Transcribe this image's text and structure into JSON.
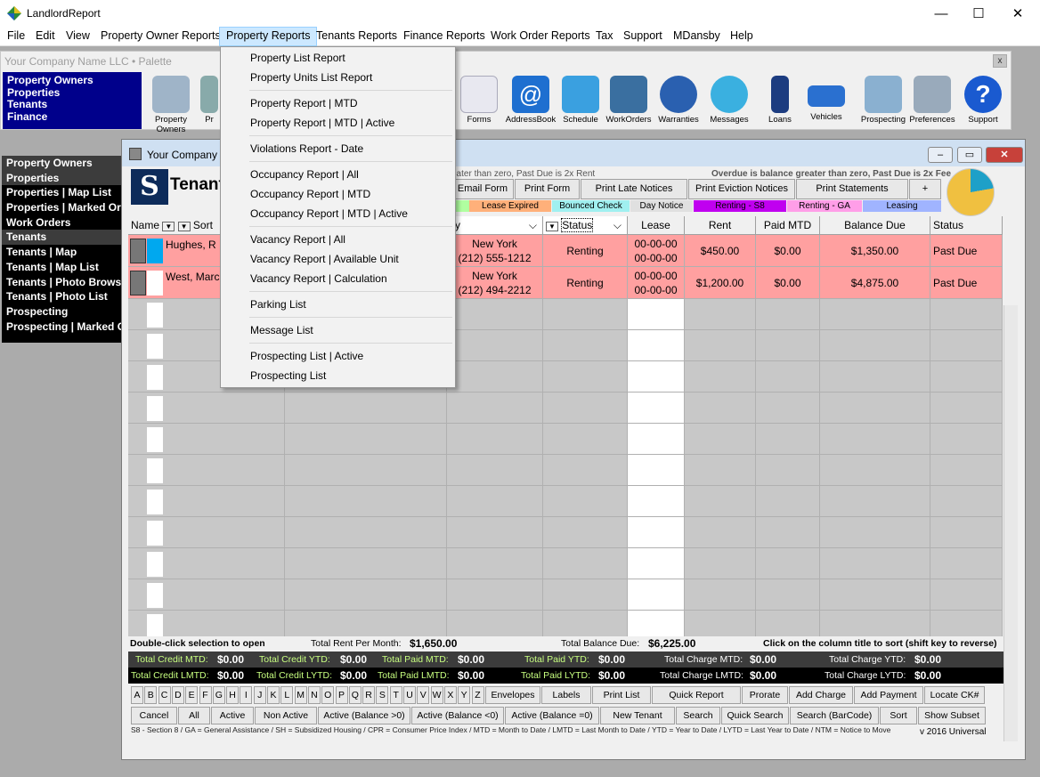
{
  "app": {
    "title": "LandlordReport"
  },
  "window_controls": {
    "minimize": "—",
    "maximize": "☐",
    "close": "✕"
  },
  "menubar": [
    "File",
    "Edit",
    "View",
    "Property Owner Reports",
    "Property Reports",
    "Tenants Reports",
    "Finance Reports",
    "Work Order Reports",
    "Tax",
    "Support",
    "MDansby",
    "Help"
  ],
  "palette": {
    "title": "Your Company Name LLC  • Palette",
    "close": "x",
    "nav": [
      "Property Owners",
      "Properties",
      "Tenants",
      "Finance"
    ],
    "icons": [
      {
        "label": "Property Owners",
        "color": "#9fb4c8"
      },
      {
        "label": "Pr",
        "color": "#8aa"
      },
      {
        "label": "Forms",
        "color": "#e8e8f0"
      },
      {
        "label": "AddressBook",
        "color": "#1e6fd0"
      },
      {
        "label": "Schedule",
        "color": "#3aa0e0"
      },
      {
        "label": "WorkOrders",
        "color": "#3a6fa0"
      },
      {
        "label": "Warranties",
        "color": "#2a60b0"
      },
      {
        "label": "Messages",
        "color": "#3ab0e0"
      },
      {
        "label": "Loans",
        "color": "#1c3c80"
      },
      {
        "label": "Vehicles",
        "color": "#2a70d0"
      },
      {
        "label": "Prospecting",
        "color": "#8ab0d0"
      },
      {
        "label": "Preferences",
        "color": "#9ab"
      },
      {
        "label": "Support",
        "color": "#1a5ad0"
      }
    ]
  },
  "leftnav": [
    "Property Owners",
    "Properties",
    "Properties | Map List",
    "Properties | Marked Or",
    "Work Orders",
    "Tenants",
    "Tenants | Map",
    "Tenants | Map List",
    "Tenants | Photo Brows",
    "Tenants | Photo List",
    "Prospecting",
    "Prospecting | Marked C"
  ],
  "child": {
    "title": "Your Company",
    "brand": "Tenant",
    "logo": "S",
    "note_left": "eater than zero, Past Due is 2x Rent",
    "note_right": "Overdue is balance greater than zero, Past Due is 2x Fee",
    "buttons": [
      "Email Form",
      "Print Form",
      "Print Late Notices",
      "Print Eviction Notices",
      "Print Statements",
      "+"
    ],
    "legend": [
      {
        "label": "Lease Expired",
        "color": "#ffb07a"
      },
      {
        "label": "Bounced Check",
        "color": "#a0f0f0"
      },
      {
        "label": "Day Notice",
        "color": "#e0e0e0"
      },
      {
        "label": "Renting - S8",
        "color": "#c000f0"
      },
      {
        "label": "Renting - GA",
        "color": "#ff9ee8"
      },
      {
        "label": "Leasing",
        "color": "#a0b4ff"
      }
    ],
    "headers": {
      "name": "Name",
      "sort": "Sort",
      "city": "ity",
      "status_filter": "Status",
      "lease": "Lease",
      "rent": "Rent",
      "paid": "Paid MTD",
      "balance": "Balance Due",
      "status": "Status"
    },
    "rows": [
      {
        "name": "Hughes, R",
        "city": "New York",
        "phone": "(212) 555-1212",
        "status": "Renting",
        "lease1": "00-00-00",
        "lease2": "00-00-00",
        "rent": "$450.00",
        "paid": "$0.00",
        "balance": "$1,350.00",
        "status2": "Past Due"
      },
      {
        "name": "West, Marc",
        "city": "New York",
        "phone": "(212) 494-2212",
        "status": "Renting",
        "lease1": "00-00-00",
        "lease2": "00-00-00",
        "rent": "$1,200.00",
        "paid": "$0.00",
        "balance": "$4,875.00",
        "status2": "Past Due"
      }
    ],
    "totals": {
      "hint": "Double-click selection to open",
      "rent_label": "Total Rent Per Month:",
      "rent": "$1,650.00",
      "bal_label": "Total Balance Due:",
      "bal": "$6,225.00",
      "sort_hint": "Click on the column title to sort (shift key to reverse)",
      "credit_mtd_l": "Total Credit MTD:",
      "credit_mtd": "$0.00",
      "credit_ytd_l": "Total Credit YTD:",
      "credit_ytd": "$0.00",
      "paid_mtd_l": "Total Paid MTD:",
      "paid_mtd": "$0.00",
      "paid_ytd_l": "Total Paid YTD:",
      "paid_ytd": "$0.00",
      "charge_mtd_l": "Total Charge MTD:",
      "charge_mtd": "$0.00",
      "charge_ytd_l": "Total Charge YTD:",
      "charge_ytd": "$0.00",
      "credit_lmtd_l": "Total Credit LMTD:",
      "credit_lmtd": "$0.00",
      "credit_lytd_l": "Total Credit LYTD:",
      "credit_lytd": "$0.00",
      "paid_lmtd_l": "Total Paid LMTD:",
      "paid_lmtd": "$0.00",
      "paid_lytd_l": "Total Paid LYTD:",
      "paid_lytd": "$0.00",
      "charge_lmtd_l": "Total Charge LMTD:",
      "charge_lmtd": "$0.00",
      "charge_lytd_l": "Total Charge LYTD:",
      "charge_lytd": "$0.00"
    },
    "letters": [
      "A",
      "B",
      "C",
      "D",
      "E",
      "F",
      "G",
      "H",
      "I",
      "J",
      "K",
      "L",
      "M",
      "N",
      "O",
      "P",
      "Q",
      "R",
      "S",
      "T",
      "U",
      "V",
      "W",
      "X",
      "Y",
      "Z"
    ],
    "row1_buttons": [
      "Envelopes",
      "Labels",
      "Print List",
      "Quick Report",
      "Prorate",
      "Add Charge",
      "Add Payment",
      "Locate CK#"
    ],
    "row2_buttons": [
      "Cancel",
      "All",
      "Active",
      "Non Active",
      "Active (Balance >0)",
      "Active (Balance <0)",
      "Active (Balance =0)",
      "New Tenant",
      "Search",
      "Quick Search",
      "Search (BarCode)",
      "Sort",
      "Show Subset"
    ],
    "footer": "S8 - Section 8  /  GA = General Assistance  /  SH = Subsidized Housing  /  CPR = Consumer Price Index  /  MTD = Month to Date  /  LMTD = Last Month to Date  /  YTD = Year to Date  /  LYTD = Last Year to Date  /  NTM = Notice to Move",
    "version": "v 2016 Universal"
  },
  "dropdown": [
    "Property List Report",
    "Property Units List Report",
    "Property Report | MTD",
    "Property Report | MTD | Active",
    "Violations Report - Date",
    "Occupancy Report | All",
    "Occupancy Report | MTD",
    "Occupancy Report | MTD | Active",
    "Vacancy Report | All",
    "Vacancy Report | Available Unit",
    "Vacancy Report | Calculation",
    "Parking List",
    "Message List",
    "Prospecting List | Active",
    "Prospecting List"
  ]
}
